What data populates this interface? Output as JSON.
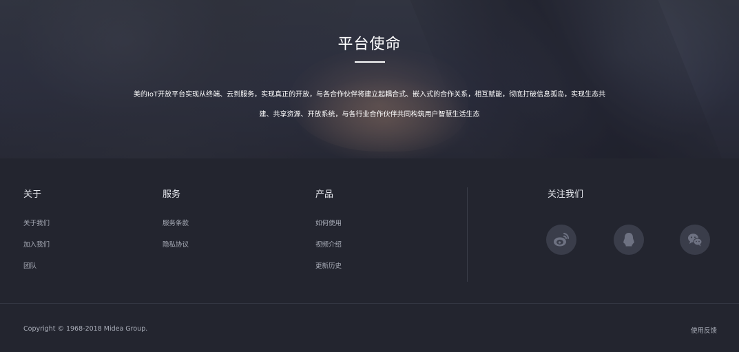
{
  "hero": {
    "title": "平台使命",
    "line1": "美的IoT开放平台实现从终端、云到服务，实现真正的开放，与各合作伙伴将建立起耦合式、嵌入式的合作关系，相互赋能，彻底打破信息孤岛，实现生态共",
    "line2": "建、共享资源、开放系统，与各行业合作伙伴共同构筑用户智慧生活生态"
  },
  "footer": {
    "about": {
      "title": "关于",
      "links": [
        "关于我们",
        "加入我们",
        "团队"
      ]
    },
    "service": {
      "title": "服务",
      "links": [
        "服务条款",
        "隐私协议"
      ]
    },
    "product": {
      "title": "产品",
      "links": [
        "如何使用",
        "视频介绍",
        "更新历史"
      ]
    },
    "follow": {
      "title": "关注我们",
      "icons": [
        "weibo-icon",
        "qq-icon",
        "wechat-icon"
      ]
    },
    "copyright": "Copyright © 1968-2018 Midea Group.",
    "feedback": "使用反馈"
  },
  "colors": {
    "footer_bg": "#23252f",
    "icon_bg": "#3a3d4a",
    "icon_fg": "#6e7282"
  }
}
